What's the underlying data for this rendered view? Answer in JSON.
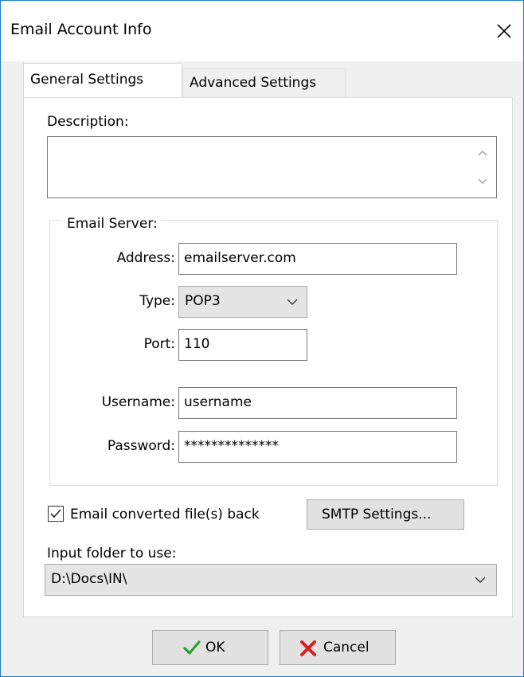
{
  "window": {
    "title": "Email Account Info"
  },
  "tabs": [
    {
      "label": "General Settings",
      "active": true
    },
    {
      "label": "Advanced Settings",
      "active": false
    }
  ],
  "description": {
    "label": "Description:",
    "value": ""
  },
  "email_server": {
    "group_label": "Email Server:",
    "address": {
      "label": "Address:",
      "value": "emailserver.com"
    },
    "type": {
      "label": "Type:",
      "value": "POP3"
    },
    "port": {
      "label": "Port:",
      "value": "110"
    },
    "username": {
      "label": "Username:",
      "value": "username"
    },
    "password": {
      "label": "Password:",
      "value": "**************"
    }
  },
  "email_back": {
    "label": "Email converted file(s) back",
    "checked": true
  },
  "smtp_button": "SMTP Settings...",
  "input_folder": {
    "label": "Input folder to use:",
    "value": "D:\\Docs\\IN\\"
  },
  "buttons": {
    "ok": "OK",
    "cancel": "Cancel"
  },
  "colors": {
    "accent_border": "#1c7cc9",
    "ok_check": "#2aa12a",
    "cancel_x": "#d42121"
  }
}
